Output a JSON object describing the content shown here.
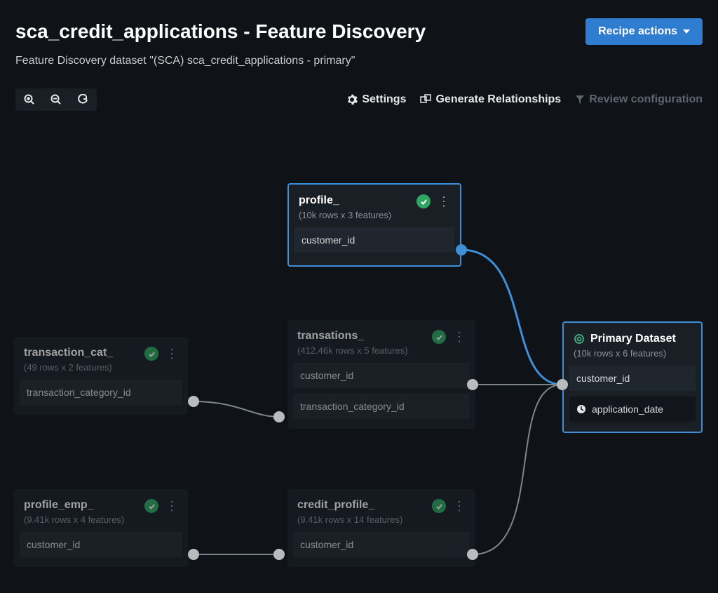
{
  "header": {
    "title": "sca_credit_applications - Feature Discovery",
    "subtitle": "Feature Discovery dataset \"(SCA) sca_credit_applications - primary\"",
    "recipe_button": "Recipe actions"
  },
  "toolbar": {
    "settings_label": "Settings",
    "generate_label": "Generate Relationships",
    "review_label": "Review configuration"
  },
  "nodes": {
    "profile": {
      "title": "profile_",
      "subtitle": "(10k rows x 3 features)",
      "rows": {
        "r0": "customer_id"
      }
    },
    "transaction_cat": {
      "title": "transaction_cat_",
      "subtitle": "(49 rows x 2 features)",
      "rows": {
        "r0": "transaction_category_id"
      }
    },
    "transations": {
      "title": "transations_",
      "subtitle": "(412.46k rows x 5 features)",
      "rows": {
        "r0": "customer_id",
        "r1": "transaction_category_id"
      }
    },
    "profile_emp": {
      "title": "profile_emp_",
      "subtitle": "(9.41k rows x 4 features)",
      "rows": {
        "r0": "customer_id"
      }
    },
    "credit_profile": {
      "title": "credit_profile_",
      "subtitle": "(9.41k rows x 14 features)",
      "rows": {
        "r0": "customer_id"
      }
    },
    "primary": {
      "title": "Primary Dataset",
      "subtitle": "(10k rows x 6 features)",
      "rows": {
        "r0": "customer_id",
        "r1": "application_date"
      }
    }
  }
}
